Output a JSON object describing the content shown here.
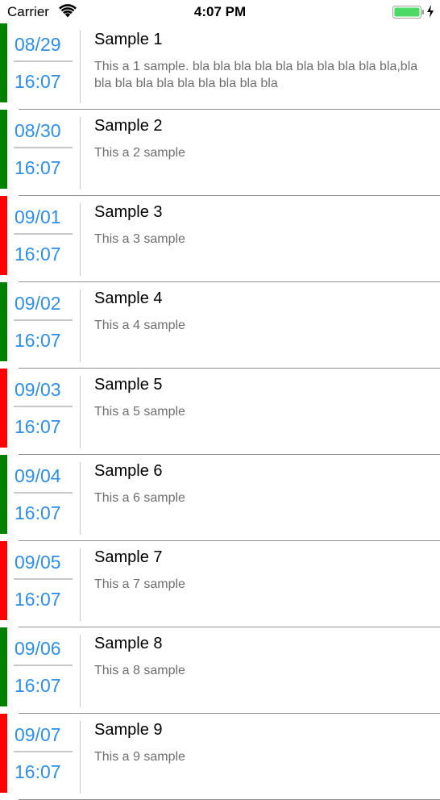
{
  "status_bar": {
    "carrier": "Carrier",
    "time": "4:07 PM",
    "battery_color": "#4cd964"
  },
  "colors": {
    "green": "#008000",
    "red": "#ff0000",
    "date_blue": "#2f8ee5"
  },
  "items": [
    {
      "date": "08/29",
      "time": "16:07",
      "title": "Sample 1",
      "description": "This a 1 sample. bla bla bla bla bla bla bla bla bla bla,bla bla bla bla bla bla bla bla bla bla",
      "status_color": "#008000"
    },
    {
      "date": "08/30",
      "time": "16:07",
      "title": "Sample 2",
      "description": "This a 2 sample",
      "status_color": "#008000"
    },
    {
      "date": "09/01",
      "time": "16:07",
      "title": "Sample 3",
      "description": "This a 3 sample",
      "status_color": "#ff0000"
    },
    {
      "date": "09/02",
      "time": "16:07",
      "title": "Sample 4",
      "description": "This a 4 sample",
      "status_color": "#008000"
    },
    {
      "date": "09/03",
      "time": "16:07",
      "title": "Sample 5",
      "description": "This a 5 sample",
      "status_color": "#ff0000"
    },
    {
      "date": "09/04",
      "time": "16:07",
      "title": "Sample 6",
      "description": "This a 6 sample",
      "status_color": "#008000"
    },
    {
      "date": "09/05",
      "time": "16:07",
      "title": "Sample 7",
      "description": "This a 7 sample",
      "status_color": "#ff0000"
    },
    {
      "date": "09/06",
      "time": "16:07",
      "title": "Sample 8",
      "description": "This a 8 sample",
      "status_color": "#008000"
    },
    {
      "date": "09/07",
      "time": "16:07",
      "title": "Sample 9",
      "description": "This a 9 sample",
      "status_color": "#ff0000"
    }
  ]
}
